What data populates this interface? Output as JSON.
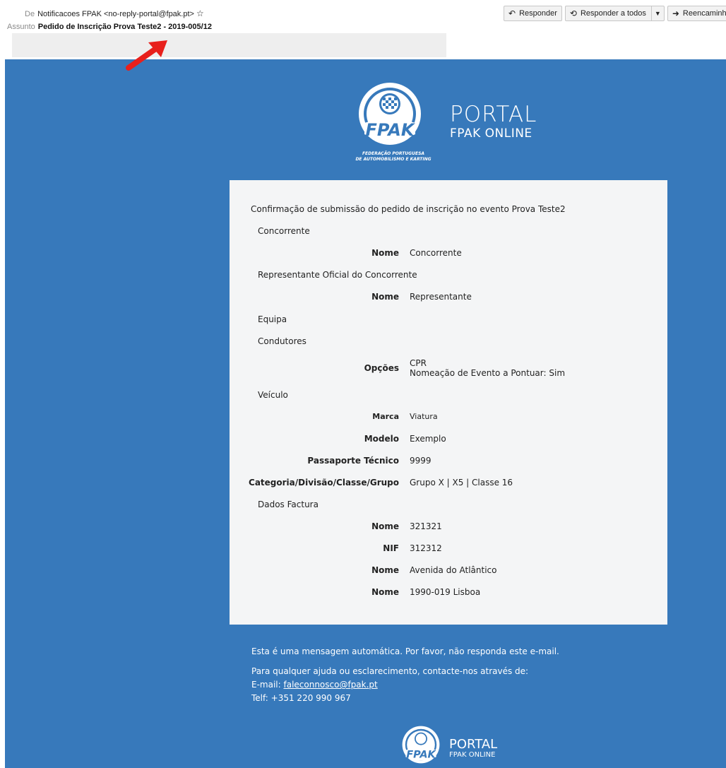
{
  "header": {
    "from_key": "De",
    "from_value": "Notificacoes FPAK <no-reply-portal@fpak.pt>",
    "subject_key": "Assunto",
    "subject_value": "Pedido de Inscrição Prova Teste2 - 2019-005/12"
  },
  "toolbar": {
    "reply": "Responder",
    "reply_all": "Responder a todos",
    "forward": "Reencaminhar"
  },
  "logo": {
    "brand": "FPAK",
    "portal_title": "PORTAL",
    "portal_subtitle": "FPAK ONLINE",
    "federation_line1": "FEDERAÇÃO PORTUGUESA",
    "federation_line2": "DE AUTOMOBILISMO E KARTING"
  },
  "card": {
    "intro": "Confirmação de submissão do pedido de inscrição no evento Prova Teste2",
    "sections": {
      "concorrente": "Concorrente",
      "representante": "Representante Oficial do Concorrente",
      "equipa": "Equipa",
      "condutores": "Condutores",
      "veiculo": "Veículo",
      "dados_factura": "Dados Factura"
    },
    "fields": {
      "concorrente_nome_label": "Nome",
      "concorrente_nome_value": "Concorrente",
      "representante_nome_label": "Nome",
      "representante_nome_value": "Representante",
      "opcoes_label": "Opções",
      "opcoes_value_1": "CPR",
      "opcoes_value_2": "Nomeação de Evento a Pontuar: Sim",
      "marca_label": "Marca",
      "marca_value": "Viatura",
      "modelo_label": "Modelo",
      "modelo_value": "Exemplo",
      "passaporte_label": "Passaporte Técnico",
      "passaporte_value": "9999",
      "categoria_label": "Categoria/Divisão/Classe/Grupo",
      "categoria_value": "Grupo X | X5 | Classe 16",
      "factura_nome1_label": "Nome",
      "factura_nome1_value": "321321",
      "nif_label": "NIF",
      "nif_value": "312312",
      "factura_nome2_label": "Nome",
      "factura_nome2_value": "Avenida do Atlântico",
      "factura_nome3_label": "Nome",
      "factura_nome3_value": "1990-019 Lisboa"
    }
  },
  "footer": {
    "auto_message": "Esta é uma mensagem automática. Por favor, não responda este e-mail.",
    "help_line": "Para qualquer ajuda ou esclarecimento, contacte-nos através de:",
    "email_label": "E-mail: ",
    "email_value": "faleconnosco@fpak.pt",
    "phone": "Telf: +351 220 990 967"
  },
  "colors": {
    "body_blue": "#3779bb",
    "card_bg": "#f4f5f6",
    "arrow_red": "#e8201c"
  },
  "icons": [
    "star-icon",
    "reply-icon",
    "reply-all-icon",
    "chevron-down-icon",
    "forward-icon",
    "print-icon",
    "fpak-logo",
    "red-arrow"
  ]
}
